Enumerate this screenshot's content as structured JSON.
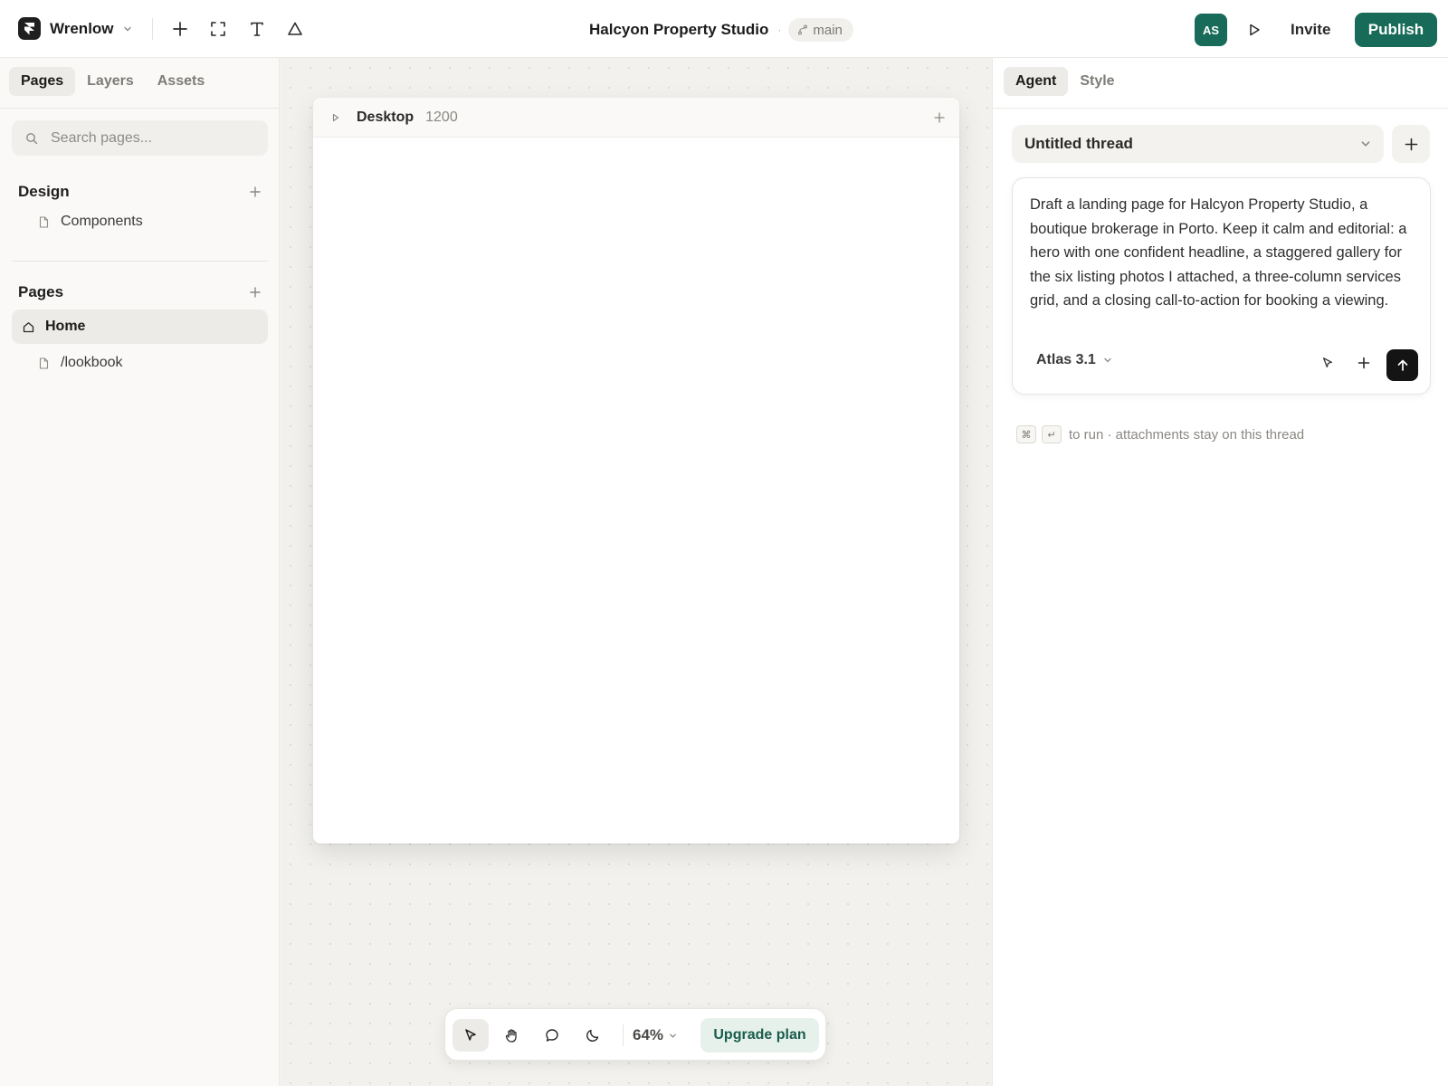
{
  "app": {
    "name": "Wrenlow"
  },
  "document": {
    "title": "Halcyon Property Studio",
    "branch": "main"
  },
  "header": {
    "avatar_initials": "AS",
    "invite_label": "Invite",
    "publish_label": "Publish"
  },
  "left_panel": {
    "tabs": [
      {
        "label": "Pages",
        "active": true
      },
      {
        "label": "Layers",
        "active": false
      },
      {
        "label": "Assets",
        "active": false
      }
    ],
    "search_placeholder": "Search pages...",
    "design_section": {
      "title": "Design",
      "items": [
        {
          "label": "Components"
        }
      ]
    },
    "pages_section": {
      "title": "Pages",
      "items": [
        {
          "label": "Home",
          "active": true,
          "icon": "home-icon"
        },
        {
          "label": "/lookbook",
          "active": false,
          "icon": "file-icon"
        }
      ]
    }
  },
  "canvas": {
    "frame": {
      "name": "Desktop",
      "width_label": "1200"
    },
    "toolbar": {
      "zoom": "64%",
      "upgrade_label": "Upgrade plan"
    }
  },
  "right_panel": {
    "tabs": [
      {
        "label": "Agent",
        "active": true
      },
      {
        "label": "Style",
        "active": false
      }
    ],
    "thread_title": "Untitled thread",
    "prompt": "Draft a landing page for Halcyon Property Studio, a boutique brokerage in Porto. Keep it calm and editorial: a hero with one confident headline, a staggered gallery for the six listing photos I attached, a three-column services grid, and a closing call-to-action for booking a viewing.",
    "model": "Atlas 3.1",
    "hint": {
      "key1": "⌘",
      "key2": "↵",
      "text": "to run · attachments stay on this thread"
    }
  },
  "colors": {
    "accent": "#176b58",
    "upgrade_bg": "#e6f1ec",
    "send": "#141414"
  }
}
